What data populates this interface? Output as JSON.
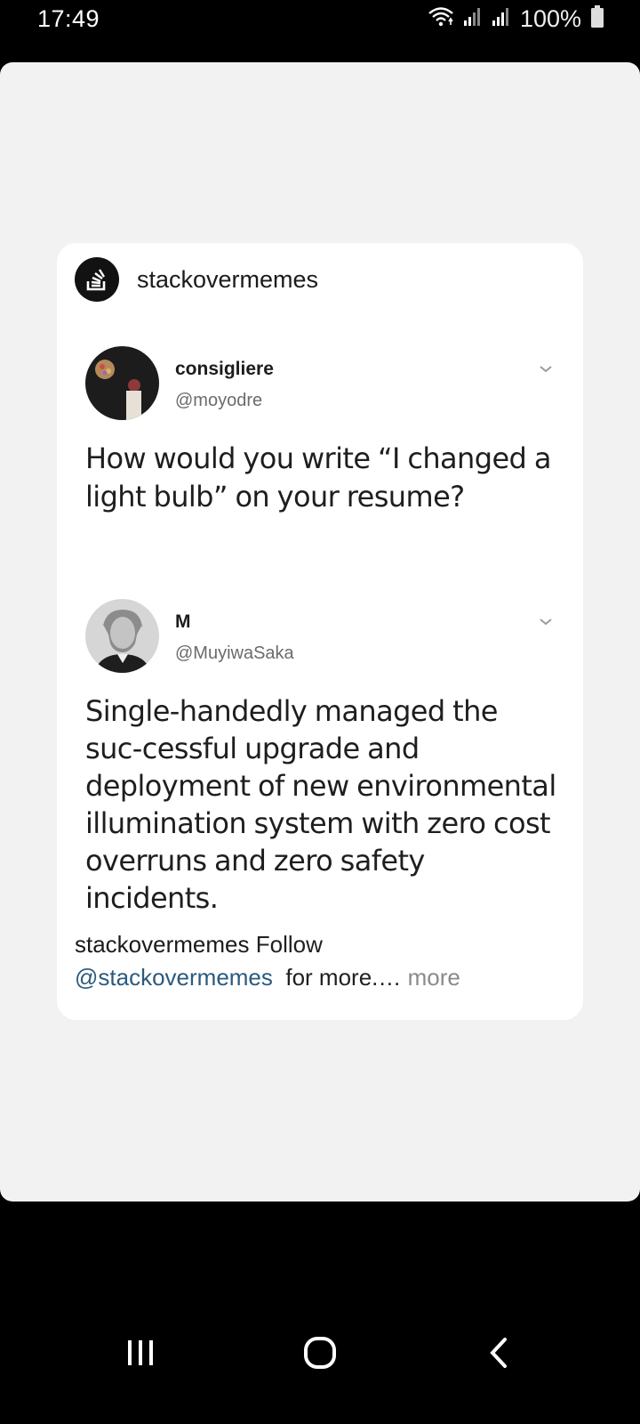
{
  "status_bar": {
    "time": "17:49",
    "battery": "100%",
    "icons": [
      "wifi-icon",
      "signal-icon",
      "signal-icon",
      "battery-icon"
    ]
  },
  "post": {
    "account": "stackovermemes",
    "logo_icon": "stack-overflow-logo-icon",
    "tweets": [
      {
        "display_name": "consigliere",
        "handle": "@moyodre",
        "text": "How would you write “I changed a light bulb” on your resume?"
      },
      {
        "display_name": "M",
        "handle": "@MuyiwaSaka",
        "text": "Single-handedly managed the suc-cessful upgrade and deployment of new environmental illumination system with zero cost overruns and zero safety incidents."
      }
    ],
    "caption": {
      "user": "stackovermemes",
      "text": "Follow",
      "mention": "@stackovermemes",
      "suffix": "for more.…",
      "more": "more"
    }
  },
  "nav_bar": {
    "icons": [
      "recent-apps-icon",
      "home-icon",
      "back-icon"
    ]
  },
  "colors": {
    "background": "#000000",
    "screen": "#f2f2f2",
    "card": "#ffffff",
    "mention": "#2b5a7e"
  }
}
